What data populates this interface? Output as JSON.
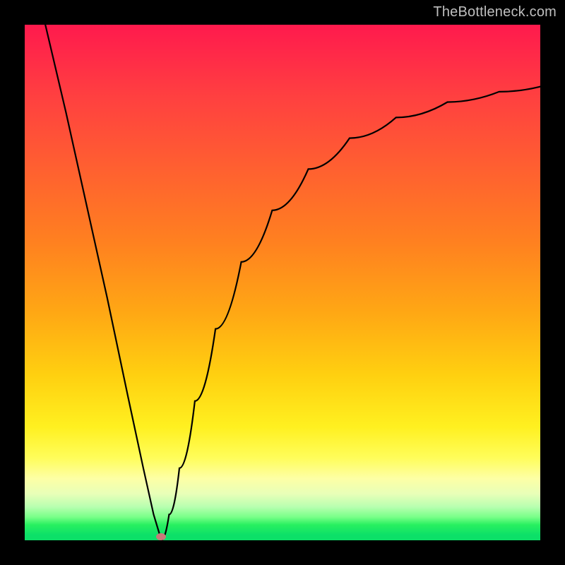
{
  "watermark": "TheBottleneck.com",
  "marker": {
    "x_pct": 26.5,
    "y_pct": 99.3
  },
  "chart_data": {
    "type": "line",
    "title": "",
    "xlabel": "",
    "ylabel": "",
    "xlim": [
      0,
      100
    ],
    "ylim": [
      0,
      100
    ],
    "series": [
      {
        "name": "bottleneck-curve",
        "x": [
          4,
          8,
          12,
          16,
          20,
          23,
          25,
          26.5,
          28,
          30,
          33,
          37,
          42,
          48,
          55,
          63,
          72,
          82,
          92,
          100
        ],
        "y": [
          100,
          83,
          65,
          47,
          28,
          14,
          5,
          0,
          5,
          14,
          27,
          41,
          54,
          64,
          72,
          78,
          82,
          85,
          87,
          88
        ]
      }
    ],
    "annotations": [
      {
        "name": "marker",
        "x": 26.5,
        "y": 0
      }
    ],
    "background_gradient": {
      "direction": "vertical",
      "stops": [
        {
          "pct": 0,
          "color": "#ff1a4d"
        },
        {
          "pct": 50,
          "color": "#ff9018"
        },
        {
          "pct": 80,
          "color": "#fff24a"
        },
        {
          "pct": 100,
          "color": "#0ce068"
        }
      ]
    }
  }
}
